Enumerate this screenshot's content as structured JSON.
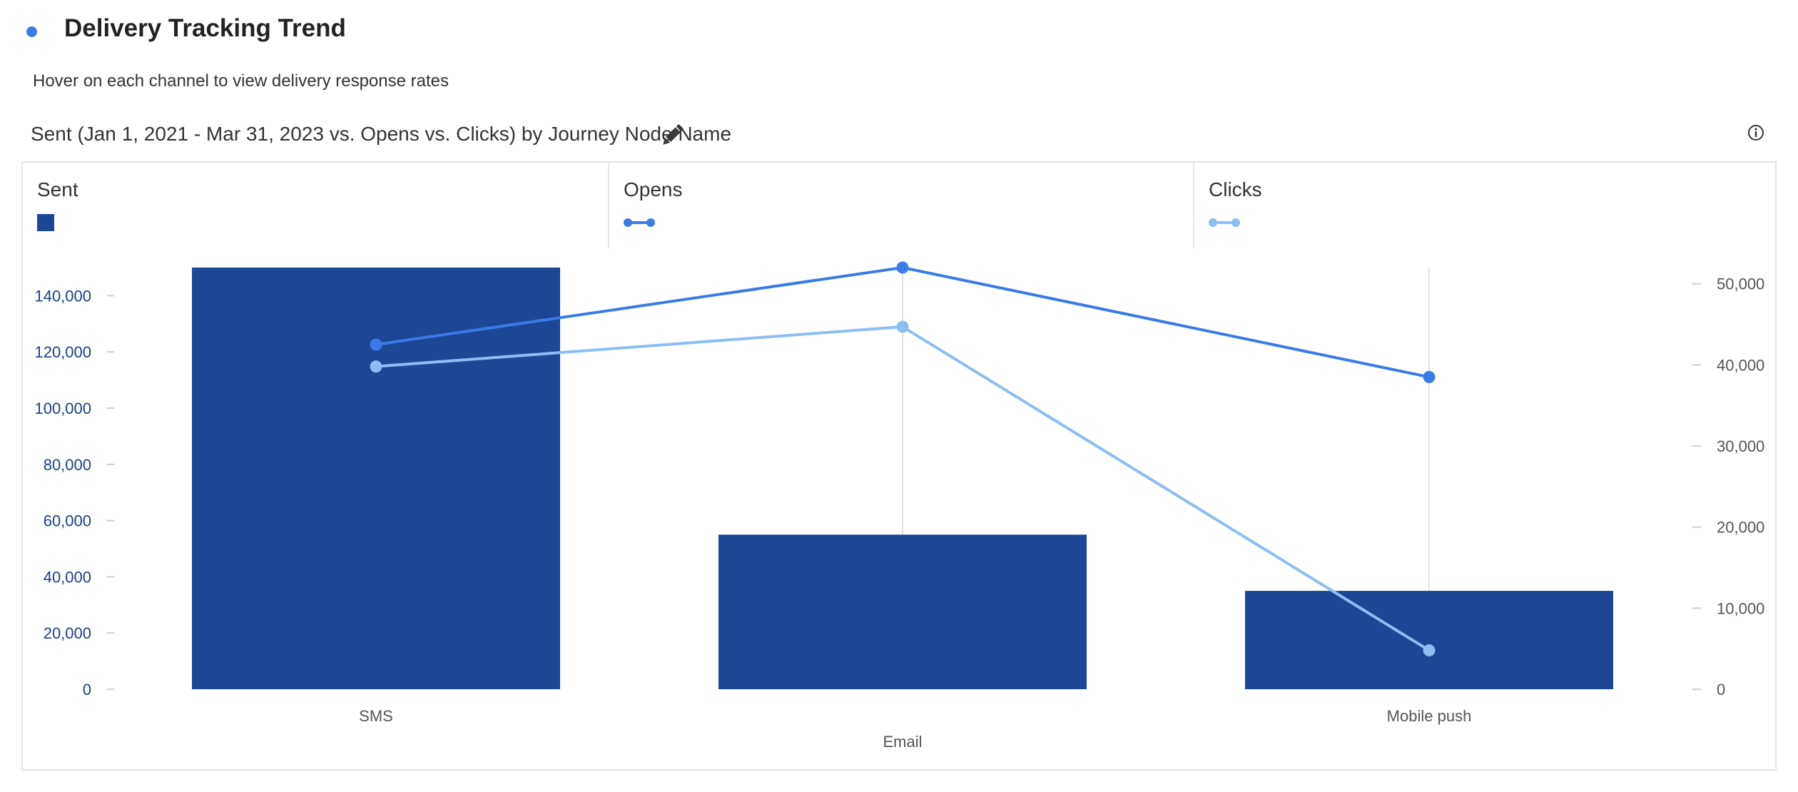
{
  "header": {
    "title": "Delivery Tracking Trend",
    "subtitle": "Hover on each channel to view delivery response rates",
    "chart_title": "Sent (Jan 1, 2021 - Mar 31, 2023 vs. Opens vs. Clicks) by Journey Node Name"
  },
  "icons": {
    "edit": "pencil-icon",
    "info": "info-icon"
  },
  "colors": {
    "sent": "#1c4794",
    "opens": "#3b7be6",
    "clicks": "#8dbdf2",
    "accent": "#3b7be6"
  },
  "legend": [
    {
      "label": "Sent"
    },
    {
      "label": "Opens"
    },
    {
      "label": "Clicks"
    }
  ],
  "chart_data": {
    "type": "bar",
    "categories": [
      "SMS",
      "Email",
      "Mobile push"
    ],
    "series": [
      {
        "name": "Sent",
        "type": "bar",
        "axis": "left",
        "values": [
          150000,
          55000,
          35000
        ]
      },
      {
        "name": "Opens",
        "type": "line",
        "axis": "right",
        "values": [
          42500,
          52000,
          38500
        ]
      },
      {
        "name": "Clicks",
        "type": "line",
        "axis": "right",
        "values": [
          39800,
          44700,
          4800
        ]
      }
    ],
    "y_left": {
      "ticks": [
        "0",
        "20,000",
        "40,000",
        "60,000",
        "80,000",
        "100,000",
        "120,000",
        "140,000"
      ],
      "ylim": [
        0,
        150000
      ]
    },
    "y_right": {
      "ticks": [
        "0",
        "10,000",
        "20,000",
        "30,000",
        "40,000",
        "50,000"
      ],
      "ylim": [
        0,
        52000
      ]
    },
    "grid": false,
    "legend_position": "top"
  }
}
